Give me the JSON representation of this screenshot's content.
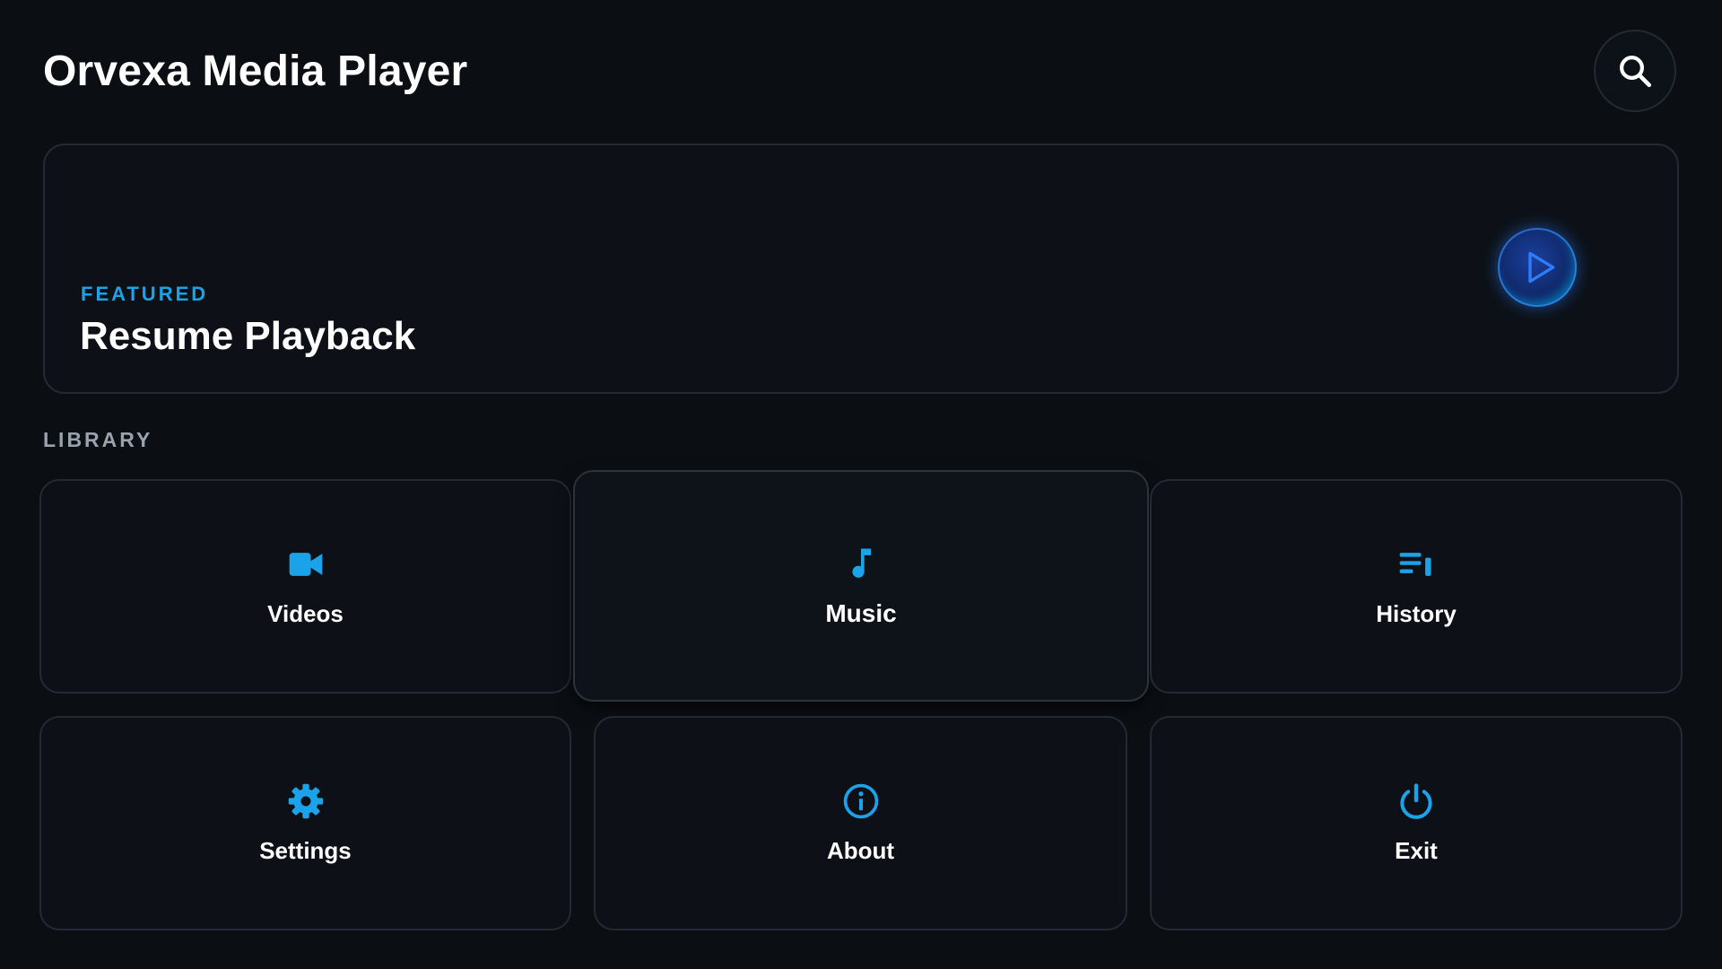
{
  "header": {
    "title": "Orvexa Media Player",
    "search_icon": "search-icon"
  },
  "featured": {
    "kicker": "FEATURED",
    "title": "Resume Playback",
    "play_icon": "play-icon"
  },
  "library": {
    "label": "LIBRARY",
    "tiles": [
      {
        "label": "Videos",
        "icon": "video-camera-icon"
      },
      {
        "label": "Music",
        "icon": "music-note-icon"
      },
      {
        "label": "History",
        "icon": "playlist-icon"
      },
      {
        "label": "Settings",
        "icon": "gear-icon"
      },
      {
        "label": "About",
        "icon": "info-icon"
      },
      {
        "label": "Exit",
        "icon": "power-icon"
      }
    ]
  },
  "colors": {
    "background": "#0b0f14",
    "accent": "#1aa3e8",
    "card_border": "#232a33",
    "muted_text": "#9aa3ad"
  }
}
